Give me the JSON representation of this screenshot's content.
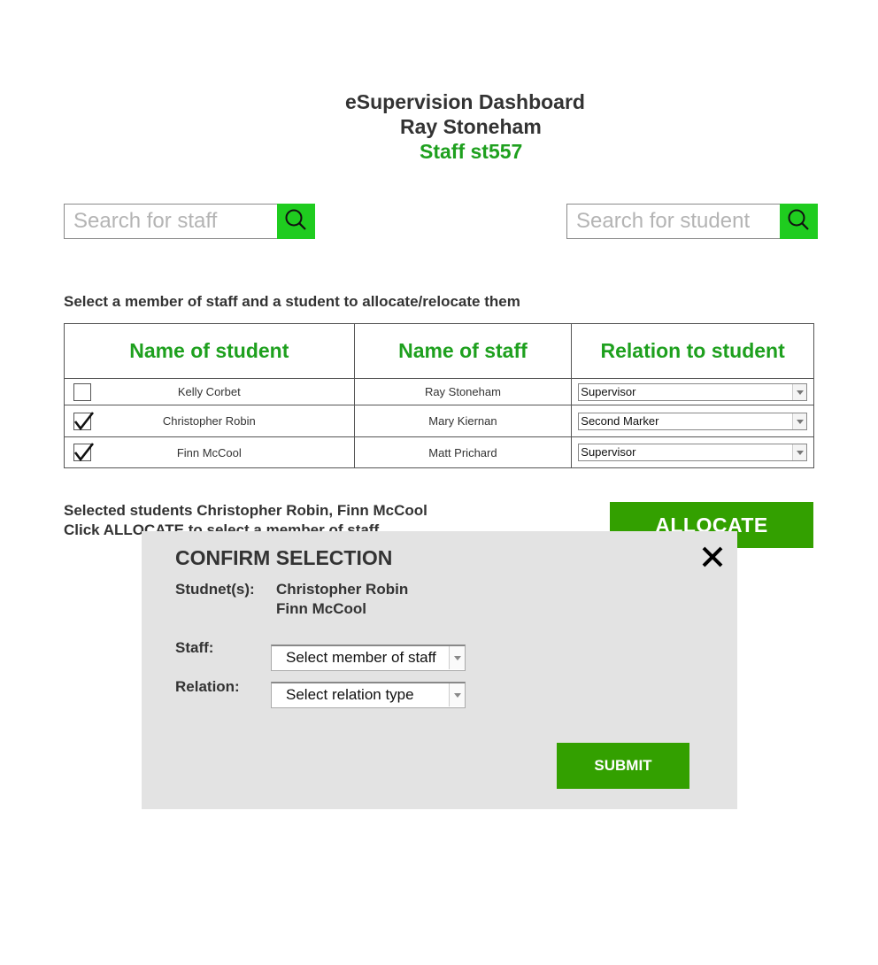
{
  "header": {
    "title": "eSupervision Dashboard",
    "user_name": "Ray Stoneham",
    "staff_id": "Staff st557"
  },
  "search": {
    "staff_placeholder": "Search for staff",
    "student_placeholder": "Search for student"
  },
  "instruction": "Select a member of staff  and a student to allocate/relocate them",
  "table": {
    "headers": [
      "Name of student",
      "Name of staff",
      "Relation to student"
    ],
    "rows": [
      {
        "checked": false,
        "student": "Kelly Corbet",
        "staff": "Ray Stoneham",
        "relation": "Supervisor"
      },
      {
        "checked": true,
        "student": "Christopher Robin",
        "staff": "Mary Kiernan",
        "relation": "Second Marker"
      },
      {
        "checked": true,
        "student": "Finn McCool",
        "staff": "Matt Prichard",
        "relation": "Supervisor"
      }
    ]
  },
  "selection": {
    "selected_text": "Selected students Christopher Robin, Finn McCool",
    "click_text": "Click ALLOCATE to select a member of staff"
  },
  "allocate_label": "ALLOCATE",
  "modal": {
    "title": "CONFIRM SELECTION",
    "students_label": "Studnet(s):",
    "students": [
      "Christopher Robin",
      "Finn McCool"
    ],
    "staff_label": "Staff:",
    "staff_select": "Select member of staff",
    "relation_label": "Relation:",
    "relation_select": "Select relation type",
    "submit_label": "SUBMIT"
  },
  "colors": {
    "accent_green": "#1ea01e",
    "search_button": "#1fcc1f",
    "button_green": "#33a000",
    "modal_bg": "#e3e3e3"
  },
  "icons": {
    "search": "search-icon",
    "close": "close-icon",
    "check": "checkmark-icon",
    "dropdown": "chevron-down-icon"
  }
}
